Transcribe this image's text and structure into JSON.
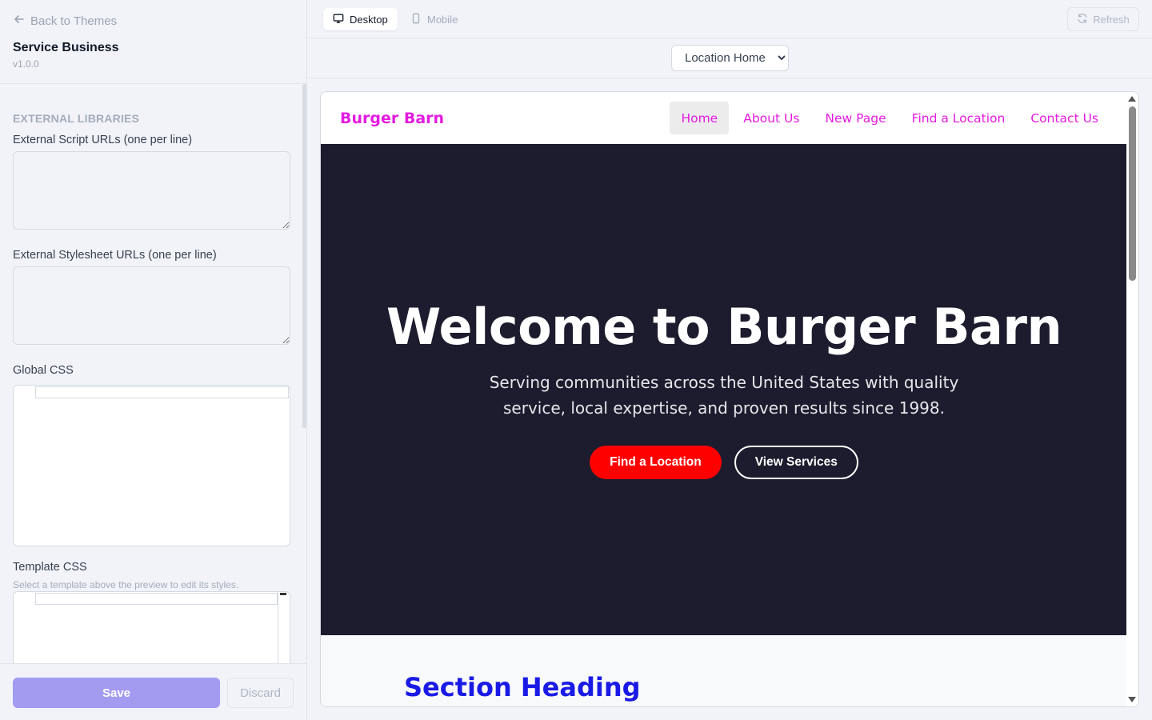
{
  "sidebar": {
    "back_label": "Back to Themes",
    "theme_name": "Service Business",
    "theme_version": "v1.0.0",
    "section_label": "EXTERNAL LIBRARIES",
    "fields": {
      "script_urls_label": "External Script URLs (one per line)",
      "stylesheet_urls_label": "External Stylesheet URLs (one per line)",
      "global_css_label": "Global CSS",
      "template_css_label": "Template CSS",
      "template_css_help": "Select a template above the preview to edit its styles."
    },
    "footer": {
      "save_label": "Save",
      "discard_label": "Discard"
    }
  },
  "toolbar": {
    "desktop_label": "Desktop",
    "mobile_label": "Mobile",
    "refresh_label": "Refresh",
    "template_select_value": "Location Home"
  },
  "preview": {
    "brand": "Burger Barn",
    "nav": [
      "Home",
      "About Us",
      "New Page",
      "Find a Location",
      "Contact Us"
    ],
    "hero_title": "Welcome to Burger Barn",
    "hero_subtitle": "Serving communities across the United States with quality service, local expertise, and proven results since 1998.",
    "primary_cta": "Find a Location",
    "secondary_cta": "View Services",
    "section_heading": "Section Heading"
  },
  "colors": {
    "accent": "#a29bf0",
    "brand_pink": "#e31be0",
    "hero_bg": "#1c1c2e",
    "cta_red": "#ff0000",
    "section_heading_blue": "#1a1ae6"
  }
}
